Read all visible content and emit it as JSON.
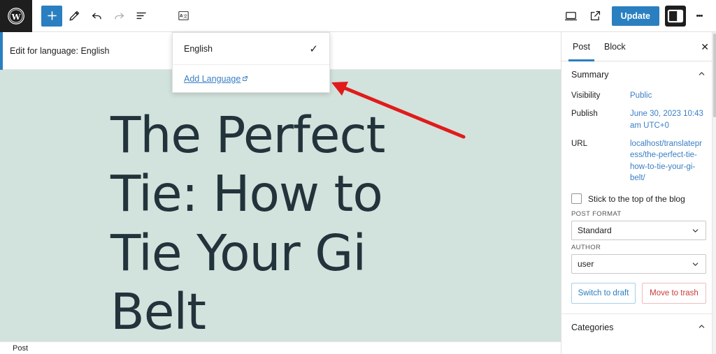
{
  "toolbar": {
    "logo_name": "wordpress-logo",
    "add_block_label": "+",
    "buttons": [
      {
        "name": "add-block-button",
        "label": "Add block"
      },
      {
        "name": "edit-tool-button",
        "label": "Edit"
      },
      {
        "name": "undo-button",
        "label": "Undo"
      },
      {
        "name": "redo-button",
        "label": "Redo"
      },
      {
        "name": "document-overview-button",
        "label": "Document Overview"
      },
      {
        "name": "translatepress-language-button",
        "label": "TranslatePress Language"
      }
    ],
    "view_label": "View",
    "preview_label": "Preview in new tab",
    "update_label": "Update",
    "sidebar_toggle_label": "Settings",
    "options_label": "Options"
  },
  "notice": {
    "text": "Edit for language: English",
    "accent_color": "#2a7fc0"
  },
  "language_menu": {
    "current_language": "English",
    "checkmark": "✓",
    "add_language_label": "Add Language"
  },
  "canvas": {
    "background_color": "#d2e2dc",
    "post_title": "The Perfect Tie: How to Tie Your Gi Belt"
  },
  "annotation": {
    "arrow_color": "#e01b1b"
  },
  "bottom_bar": {
    "breadcrumb": "Post"
  },
  "sidebar": {
    "tabs": [
      {
        "label": "Post",
        "active": true
      },
      {
        "label": "Block",
        "active": false
      }
    ],
    "close_label": "✕",
    "summary": {
      "title": "Summary",
      "rows": [
        {
          "label": "Visibility",
          "value": "Public"
        },
        {
          "label": "Publish",
          "value": "June 30, 2023 10:43 am UTC+0"
        },
        {
          "label": "URL",
          "value": "localhost/translatepress/the-perfect-tie-how-to-tie-your-gi-belt/"
        }
      ],
      "sticky_label": "Stick to the top of the blog",
      "sticky_checked": false,
      "post_format_label": "POST FORMAT",
      "post_format_value": "Standard",
      "author_label": "AUTHOR",
      "author_value": "user",
      "switch_draft_label": "Switch to draft",
      "move_trash_label": "Move to trash"
    },
    "categories": {
      "title": "Categories"
    }
  },
  "colors": {
    "accent_blue": "#2a7fc0",
    "link_blue": "#3a7fc4",
    "danger_red": "#cc3c3c",
    "canvas_green": "#d2e2dc",
    "title_ink": "#22333b"
  }
}
